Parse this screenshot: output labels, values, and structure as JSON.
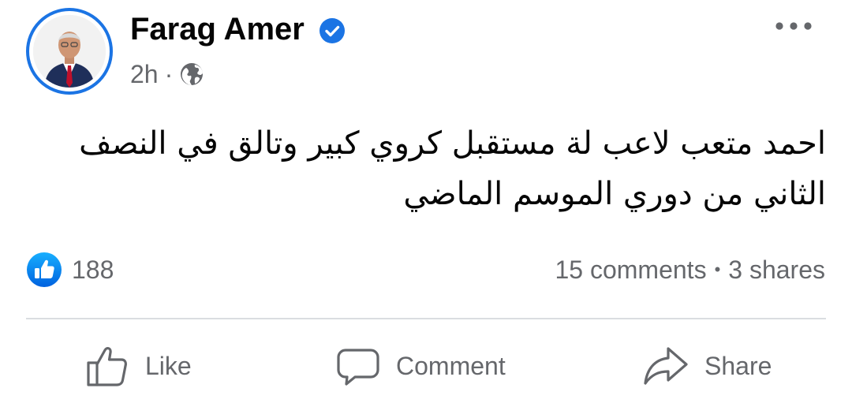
{
  "post": {
    "author": "Farag Amer",
    "verified": true,
    "time": "2h",
    "separator": "·",
    "audience_icon": "globe-icon",
    "text": "احمد متعب لاعب لة مستقبل كروي كبير  وتالق في النصف الثاني من دوري الموسم الماضي"
  },
  "reactions": {
    "icon": "like-reaction-icon",
    "count": "188"
  },
  "engagement": {
    "comments": "15 comments",
    "separator": "•",
    "shares": "3 shares"
  },
  "actions": {
    "like_label": "Like",
    "comment_label": "Comment",
    "share_label": "Share"
  },
  "colors": {
    "accent": "#1b74e4",
    "secondary_text": "#65676b",
    "divider": "#dadde1"
  }
}
